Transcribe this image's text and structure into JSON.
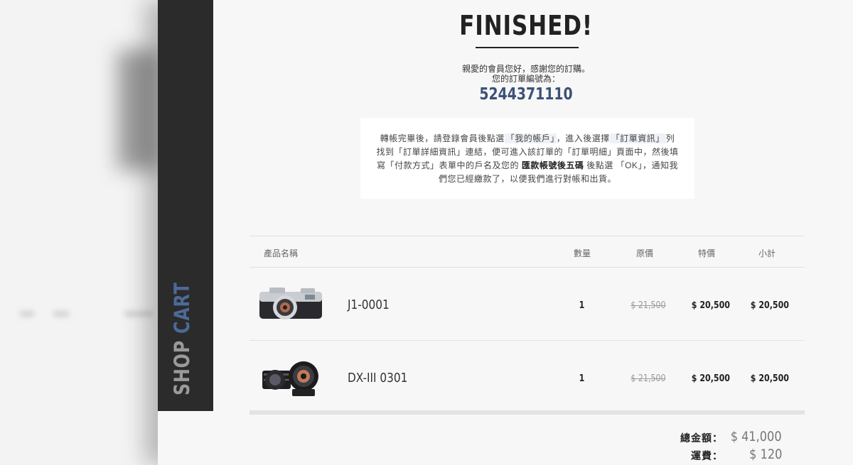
{
  "sidebar": {
    "title_part1": "SHOP ",
    "title_part2": "CART"
  },
  "heading": "FINISHED!",
  "thanks_line1": "親愛的會員您好，感謝您的訂購。",
  "thanks_line2": "您的訂單編號為：",
  "order_number": "5244371110",
  "notice": {
    "t1": "轉帳完畢後，請登錄會員後點選",
    "hl1": "「我的帳戶」",
    "t2": "，進入後選擇",
    "hl2": "「訂單資訊」",
    "t3": "列找到「訂單詳細資訊」連結，便可進入該訂單的「訂單明細」頁面中，然後填寫「付款方式」表單中的戶名及您的",
    "bold": "匯款帳號後五碼",
    "t4": "後點選 「OK」，通知我們您已經繳款了，以便我們進行對帳和出貨。"
  },
  "table": {
    "headers": {
      "name": "產品名稱",
      "qty": "數量",
      "orig": "原價",
      "special": "特價",
      "subtotal": "小計"
    },
    "rows": [
      {
        "name": "J1-0001",
        "qty": "1",
        "orig": "$ 21,500",
        "special": "$ 20,500",
        "subtotal": "$ 20,500",
        "image": "camera-image"
      },
      {
        "name": "DX-III 0301",
        "qty": "1",
        "orig": "$ 21,500",
        "special": "$ 20,500",
        "subtotal": "$ 20,500",
        "image": "lens-image"
      }
    ]
  },
  "totals": {
    "total_label": "總金額：",
    "total_value": "$ 41,000",
    "shipping_label": "運費：",
    "shipping_value": "$ 120"
  },
  "colors": {
    "accent": "#4d6a96",
    "order_number": "#3c5176",
    "sidebar_bg": "#2b2b2b"
  }
}
